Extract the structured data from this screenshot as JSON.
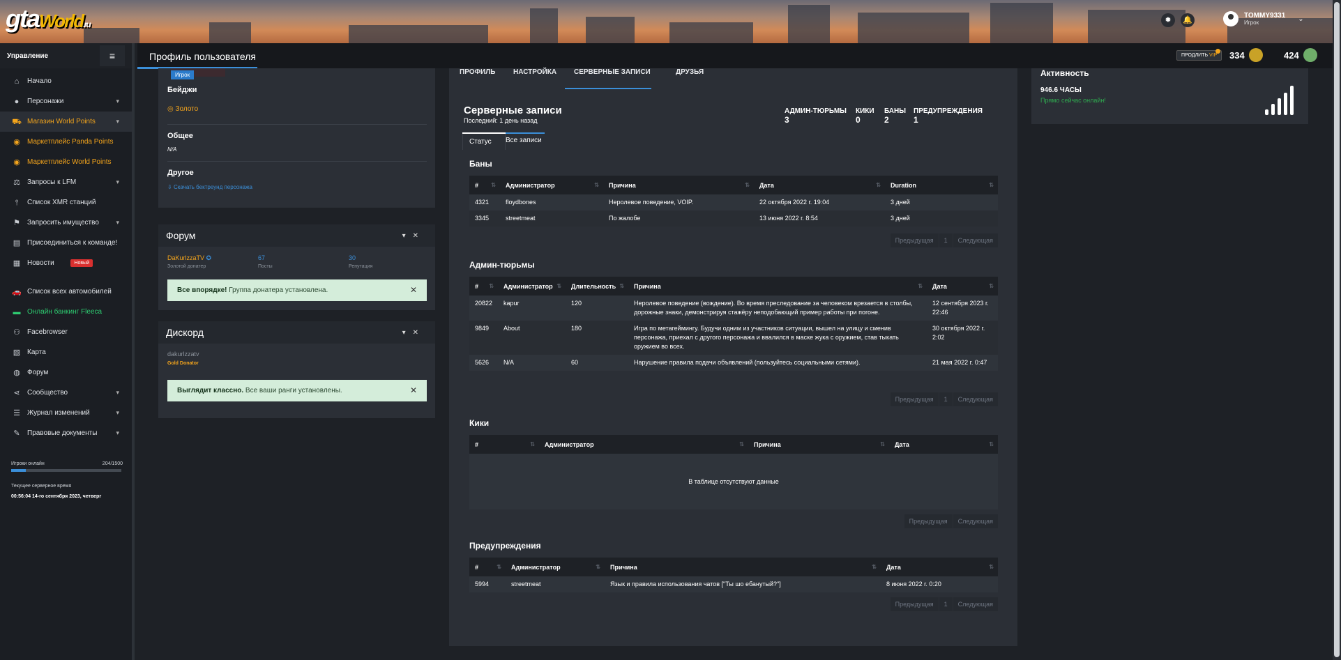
{
  "header": {
    "logo_main": "gta",
    "logo_world": "World",
    "logo_ru": ".ru",
    "username": "TOMMY9331",
    "user_role": "Игрок"
  },
  "topbar": {
    "page_title": "Профиль пользователя",
    "vip_label_pre": "ПРОДЛИТЬ",
    "vip_label_accent": "VIP",
    "stat1": "334",
    "stat2": "424"
  },
  "sidebar": {
    "title": "Управление",
    "items": [
      {
        "label": "Начало",
        "icon": "home-icon"
      },
      {
        "label": "Персонажи",
        "icon": "users-icon"
      },
      {
        "label": "Магазин World Points",
        "icon": "cart-icon"
      },
      {
        "label": "Маркетплейс Panda Points",
        "icon": "coins-icon"
      },
      {
        "label": "Маркетплейс World Points",
        "icon": "coins-icon"
      },
      {
        "label": "Запросы к LFM",
        "icon": "scale-icon"
      },
      {
        "label": "Список XMR станций",
        "icon": "antenna-icon"
      },
      {
        "label": "Запросить имущество",
        "icon": "signpost-icon"
      },
      {
        "label": "Присоединиться к команде!",
        "icon": "id-card-icon"
      },
      {
        "label": "Новости",
        "icon": "newspaper-icon",
        "badge": "Новый"
      },
      {
        "label": "Список всех автомобилей",
        "icon": "car-icon"
      },
      {
        "label": "Онлайн банкинг Fleeca",
        "icon": "money-icon"
      },
      {
        "label": "Facebrowser",
        "icon": "people-icon"
      },
      {
        "label": "Карта",
        "icon": "map-icon"
      },
      {
        "label": "Форум",
        "icon": "comments-icon"
      },
      {
        "label": "Сообщество",
        "icon": "share-icon"
      },
      {
        "label": "Журнал изменений",
        "icon": "list-icon"
      },
      {
        "label": "Правовые документы",
        "icon": "document-icon"
      }
    ],
    "online_label": "Игроки онлайн",
    "online_value": "204/1500",
    "online_fraction": 0.136,
    "time_label": "Текущее серверное время",
    "time_value": "00:56:04 14-го сентября 2023, четверг"
  },
  "left": {
    "role_tag": "Игрок",
    "badges_title": "Бейджи",
    "badge_gold": "Золото",
    "general_title": "Общее",
    "general_value": "N/A",
    "other_title": "Другое",
    "other_link": "Скачать бектреунд персонажа",
    "forum": {
      "title": "Форум",
      "user": "DaKurlzzaTV",
      "user_sub": "Золотой донатер",
      "posts_val": "67",
      "posts_lbl": "Посты",
      "rep_val": "30",
      "rep_lbl": "Репутация",
      "alert_bold": "Все впорядке!",
      "alert_text": " Группа донатера установлена."
    },
    "discord": {
      "title": "Дискорд",
      "user": "dakurlzzatv",
      "role": "Gold Donator",
      "alert_bold": "Выглядит классно.",
      "alert_text": " Все ваши ранги установлены."
    }
  },
  "center": {
    "tabs": [
      "ПРОФИЛЬ",
      "НАСТРОЙКА",
      "СЕРВЕРНЫЕ ЗАПИСИ",
      "ДРУЗЬЯ"
    ],
    "title": "Серверные записи",
    "subtitle": "Последний: 1 день назад",
    "counts": [
      {
        "label": "АДМИН-ТЮРЬМЫ",
        "value": "3"
      },
      {
        "label": "КИКИ",
        "value": "0"
      },
      {
        "label": "БАНЫ",
        "value": "2"
      },
      {
        "label": "ПРЕДУПРЕЖДЕНИЯ",
        "value": "1"
      }
    ],
    "subtabs": [
      "Статус",
      "Все записи"
    ],
    "pager": {
      "prev": "Предыдущая",
      "page": "1",
      "next": "Следующая"
    },
    "bans": {
      "title": "Баны",
      "headers": [
        "#",
        "Администратор",
        "Причина",
        "Дата",
        "Duration"
      ],
      "rows": [
        [
          "4321",
          "floydbones",
          "Неролевое поведение, VOIP.",
          "22 октября 2022 г. 19:04",
          "3 дней"
        ],
        [
          "3345",
          "streetmeat",
          "По жалобе",
          "13 июня 2022 г. 8:54",
          "3 дней"
        ]
      ]
    },
    "jails": {
      "title": "Админ-тюрьмы",
      "headers": [
        "#",
        "Администратор",
        "Длительность",
        "Причина",
        "Дата"
      ],
      "rows": [
        [
          "20822",
          "kapur",
          "120",
          "Неролевое поведение (вождение). Во время преследование за человеком врезается в столбы, дорожные знаки, демонстрируя стажёру неподобающий пример работы при погоне.",
          "12 сентября 2023 г. 22:46"
        ],
        [
          "9849",
          "About",
          "180",
          "Игра по метагеймингу. Будучи одним из участников ситуации, вышел на улицу и сменив персонажа, приехал с другого персонажа и ввалился в маске жука с оружием, став тыкать оружием во всех.",
          "30 октября 2022 г. 2:02"
        ],
        [
          "5626",
          "N/A",
          "60",
          "Нарушение правила подачи объявлений (пользуйтесь социальными сетями).",
          "21 мая 2022 г. 0:47"
        ]
      ]
    },
    "kicks": {
      "title": "Кики",
      "headers": [
        "#",
        "Администратор",
        "Причина",
        "Дата"
      ],
      "empty": "В таблице отсутствуют данные"
    },
    "warnings": {
      "title": "Предупреждения",
      "headers": [
        "#",
        "Администратор",
        "Причина",
        "Дата"
      ],
      "rows": [
        [
          "5994",
          "streetmeat",
          "Язык и правила использования чатов [\"Ты шо ебанутый?\"]",
          "8 июня 2022 г. 0:20"
        ]
      ]
    }
  },
  "activity": {
    "title": "Активность",
    "hours": "946.6 ЧАСЫ",
    "online": "Прямо сейчас онлайн!"
  }
}
